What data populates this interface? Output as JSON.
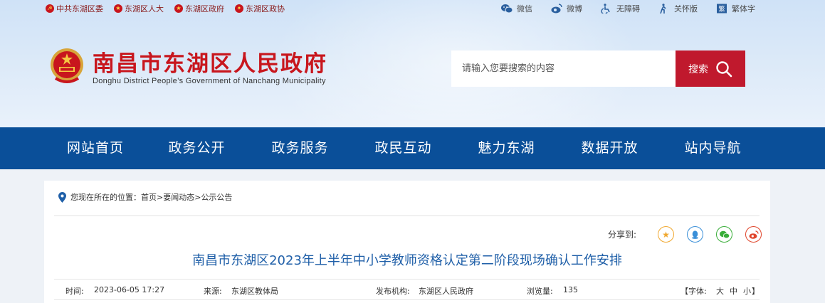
{
  "topbar": {
    "left_links": [
      {
        "label": "中共东湖区委",
        "icon": "party-emblem-icon"
      },
      {
        "label": "东湖区人大",
        "icon": "national-emblem-icon"
      },
      {
        "label": "东湖区政府",
        "icon": "national-emblem-icon"
      },
      {
        "label": "东湖区政协",
        "icon": "cppcc-emblem-icon"
      }
    ],
    "right_links": [
      {
        "label": "微信",
        "icon": "wechat-icon"
      },
      {
        "label": "微博",
        "icon": "weibo-icon"
      },
      {
        "label": "无障碍",
        "icon": "accessibility-icon"
      },
      {
        "label": "关怀版",
        "icon": "elderly-care-icon"
      },
      {
        "label": "繁体字",
        "icon": "traditional-chinese-icon"
      }
    ]
  },
  "header": {
    "site_title": "南昌市东湖区人民政府",
    "site_subtitle": "Donghu District People’s Government of Nanchang Municipality"
  },
  "search": {
    "placeholder": "请输入您要搜索的内容",
    "button_label": "搜索"
  },
  "nav": {
    "items": [
      "网站首页",
      "政务公开",
      "政务服务",
      "政民互动",
      "魅力东湖",
      "数据开放",
      "站内导航"
    ]
  },
  "breadcrumb": {
    "prefix": "您现在所在的位置：",
    "path": [
      "首页",
      "要闻动态",
      "公示公告"
    ],
    "separator": ">"
  },
  "share": {
    "label": "分享到:",
    "targets": [
      {
        "name": "qzone-icon",
        "glyph": "★",
        "color": "#f0a830"
      },
      {
        "name": "qq-icon",
        "glyph": "♟",
        "color": "#3a8fd8"
      },
      {
        "name": "wechat-share-icon",
        "glyph": "◎",
        "color": "#3aae3a"
      },
      {
        "name": "weibo-share-icon",
        "glyph": "◉",
        "color": "#e0452b"
      }
    ]
  },
  "article": {
    "title": "南昌市东湖区2023年上半年中小学教师资格认定第二阶段现场确认工作安排",
    "time_label": "时间:",
    "time_value": "2023-06-05 17:27",
    "source_label": "来源:",
    "source_value": "东湖区教体局",
    "publisher_label": "发布机构:",
    "publisher_value": "东湖区人民政府",
    "views_label": "浏览量:",
    "views_value": "135",
    "font_label": "【字体:",
    "font_large": "大",
    "font_medium": "中",
    "font_small": "小",
    "font_close": "】"
  },
  "colors": {
    "brand_red": "#c8161d",
    "nav_blue": "#0a4f99",
    "title_blue": "#1f5fa8",
    "search_red": "#c0192d"
  }
}
